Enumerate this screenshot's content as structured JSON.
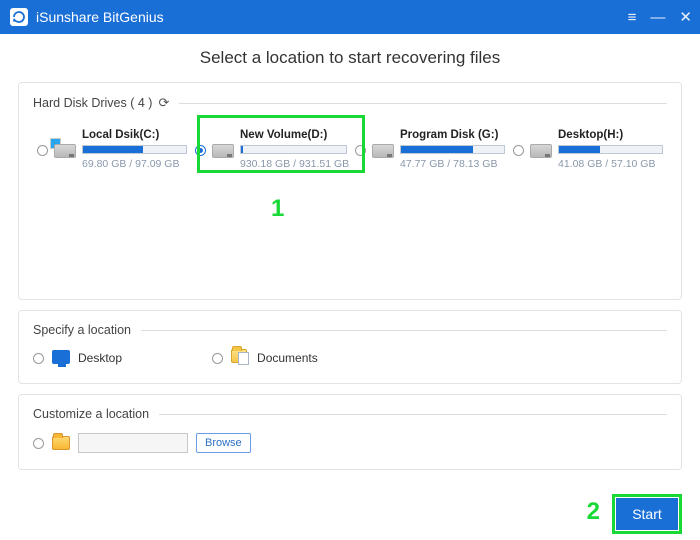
{
  "titlebar": {
    "app_name": "iSunshare BitGenius",
    "logo_glyph": "↻"
  },
  "page": {
    "title": "Select a location to start recovering files"
  },
  "hard_drives": {
    "header": "Hard Disk Drives ( 4 )",
    "items": [
      {
        "name": "Local Dsik(C:)",
        "used_label": "69.80 GB / 97.09 GB",
        "fill_pct": 58,
        "selected": false,
        "os_badge": true
      },
      {
        "name": "New Volume(D:)",
        "used_label": "930.18 GB / 931.51 GB",
        "fill_pct": 2,
        "selected": true,
        "os_badge": false
      },
      {
        "name": "Program Disk (G:)",
        "used_label": "47.77 GB / 78.13 GB",
        "fill_pct": 70,
        "selected": false,
        "os_badge": false
      },
      {
        "name": "Desktop(H:)",
        "used_label": "41.08 GB / 57.10 GB",
        "fill_pct": 40,
        "selected": false,
        "os_badge": false
      }
    ]
  },
  "specify": {
    "header": "Specify a location",
    "desktop_label": "Desktop",
    "documents_label": "Documents"
  },
  "customize": {
    "header": "Customize a location",
    "browse_label": "Browse",
    "path_value": ""
  },
  "actions": {
    "start_label": "Start"
  },
  "callouts": {
    "one": "1",
    "two": "2"
  }
}
